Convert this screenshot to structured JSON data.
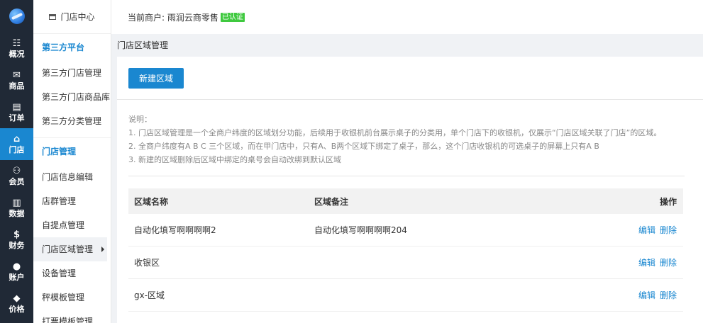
{
  "leftnav": {
    "items": [
      {
        "icon": "overview-icon",
        "glyph": "☷",
        "label": "概况"
      },
      {
        "icon": "product-icon",
        "glyph": "✉",
        "label": "商品"
      },
      {
        "icon": "order-icon",
        "glyph": "▤",
        "label": "订单"
      },
      {
        "icon": "store-icon",
        "glyph": "⌂",
        "label": "门店"
      },
      {
        "icon": "member-icon",
        "glyph": "⚇",
        "label": "会员"
      },
      {
        "icon": "data-icon",
        "glyph": "▥",
        "label": "数据"
      },
      {
        "icon": "finance-icon",
        "glyph": "$",
        "label": "财务"
      },
      {
        "icon": "account-icon",
        "glyph": "●",
        "label": "账户"
      },
      {
        "icon": "price-icon",
        "glyph": "◆",
        "label": "价格"
      }
    ]
  },
  "subnav": {
    "header": "门店中心",
    "sections": [
      {
        "title": "第三方平台",
        "items": [
          "第三方门店管理",
          "第三方门店商品库",
          "第三方分类管理"
        ]
      },
      {
        "title": "门店管理",
        "items": [
          "门店信息编辑",
          "店群管理",
          "自提点管理",
          "门店区域管理",
          "设备管理",
          "秤模板管理",
          "打票模板管理"
        ]
      }
    ]
  },
  "topbar": {
    "merchant_label": "当前商户: 雨润云商零售",
    "verified": "已认证"
  },
  "breadcrumb": "门店区域管理",
  "main": {
    "new_button": "新建区域",
    "notes": [
      "说明：",
      "1. 门店区域管理是一个全商户纬度的区域划分功能，后续用于收银机前台展示桌子的分类用，单个门店下的收银机，仅展示“门店区域关联了门店”的区域。",
      "2. 全商户纬度有A B C 三个区域，而在甲门店中，只有A、B两个区域下绑定了桌子，那么，这个门店收银机的可选桌子的屏幕上只有A B",
      "3. 新建的区域删除后区域中绑定的桌号会自动改绑到默认区域"
    ],
    "table": {
      "headers": [
        "区域名称",
        "区域备注",
        "操作"
      ],
      "rows": [
        {
          "name": "自动化填写啊啊啊啊2",
          "remark": "自动化填写啊啊啊啊204"
        },
        {
          "name": "收银区",
          "remark": ""
        },
        {
          "name": "gx-区域",
          "remark": ""
        }
      ],
      "edit_label": "编辑",
      "delete_label": "删除"
    }
  }
}
